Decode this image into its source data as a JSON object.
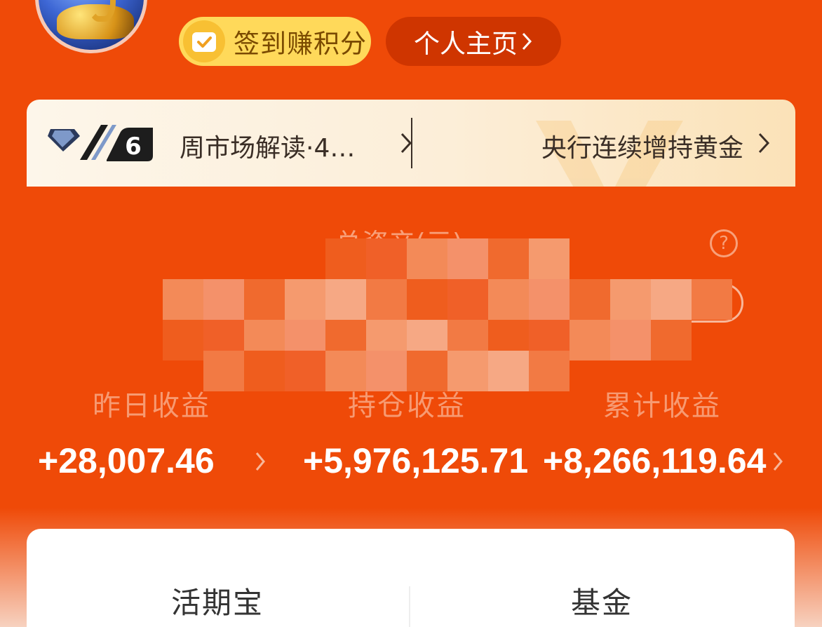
{
  "header": {
    "signin_label": "签到赚积分",
    "profile_label": "个人主页"
  },
  "info_strip": {
    "badge_level": "6",
    "left_text": "周市场解读·4…",
    "right_text": "央行连续增持黄金"
  },
  "assets": {
    "total_label": "总资产(元)",
    "total_value_redacted": true,
    "help_symbol": "?"
  },
  "stats": [
    {
      "label": "昨日收益",
      "value": "+28,007.46"
    },
    {
      "label": "持仓收益",
      "value": "+5,976,125.71"
    },
    {
      "label": "累计收益",
      "value": "+8,266,119.64"
    }
  ],
  "card": {
    "tabs": [
      "活期宝",
      "基金"
    ]
  },
  "colors": {
    "background": "#ef4a08",
    "signin_pill": "#ffd95a",
    "profile_pill": "#cf3500",
    "stat_label": "#f79a72"
  }
}
